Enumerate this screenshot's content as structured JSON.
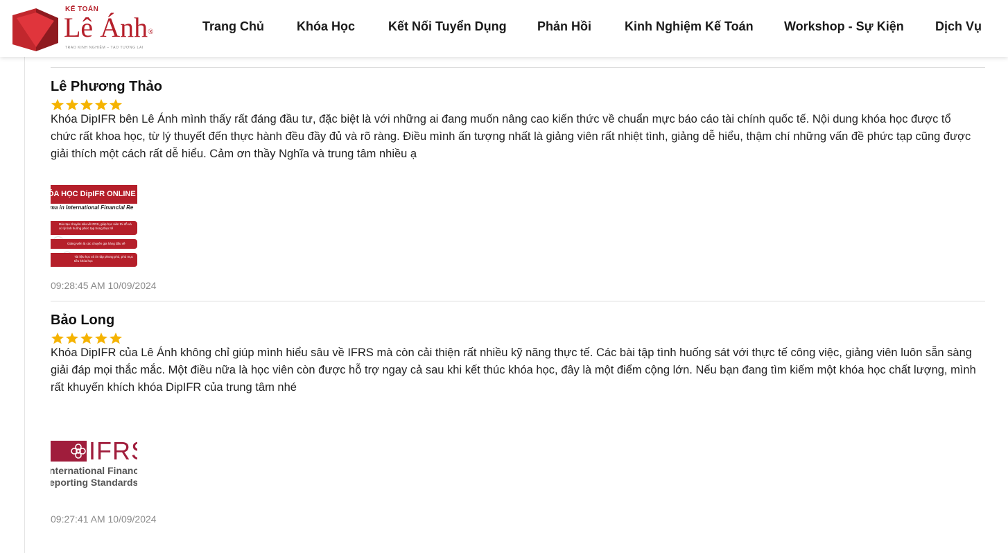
{
  "brand": {
    "top_label": "KẾ TOÁN",
    "name": "Lê Ánh",
    "registered": "®",
    "tagline": "TRAO KINH NGHIỆM – TẠO TƯƠNG LAI",
    "accent_color": "#b51f2a"
  },
  "nav": [
    {
      "label": "Trang Chủ"
    },
    {
      "label": "Khóa Học"
    },
    {
      "label": "Kết Nối Tuyển Dụng"
    },
    {
      "label": "Phản Hồi"
    },
    {
      "label": "Kinh Nghiệm Kế Toán"
    },
    {
      "label": "Workshop - Sự Kiện"
    },
    {
      "label": "Dịch Vụ"
    }
  ],
  "reviews": [
    {
      "name": "Lê Phương Thảo",
      "rating": 5,
      "text": "Khóa DipIFR bên Lê Ánh mình thấy rất đáng đầu tư, đặc biệt là với những ai đang muốn nâng cao kiến thức về chuẩn mực báo cáo tài chính quốc tế. Nội dung khóa học được tổ chức rất khoa học, từ lý thuyết đến thực hành đều đầy đủ và rõ ràng. Điều mình ấn tượng nhất là giảng viên rất nhiệt tình, giảng dễ hiểu, thậm chí những vấn đề phức tạp cũng được giải thích một cách rất dễ hiểu. Cảm ơn thầy Nghĩa và trung tâm nhiều ạ",
      "image": {
        "title": "ÓA HỌC DipIFR ONLINE",
        "subtitle": "oma in International Financial Re",
        "rows": [
          "Đào tạo chuyên sâu về IFRS, giúp học viên thi đỗ và xử lý tình huống phức tạp trong thực tế",
          "Giảng viên là các chuyên gia hàng đầu về",
          "Tài liệu học và ôn tập phong phú, phù mục tiêu khóa học"
        ]
      },
      "timestamp": "09:28:45 AM 10/09/2024"
    },
    {
      "name": "Bảo Long",
      "rating": 5,
      "text": "Khóa DipIFR của Lê Ánh không chỉ giúp mình hiểu sâu về IFRS mà còn cải thiện rất nhiều kỹ năng thực tế. Các bài tập tình huống sát với thực tế công việc, giảng viên luôn sẵn sàng giải đáp mọi thắc mắc. Một điều nữa là học viên còn được hỗ trợ ngay cả sau khi kết thúc khóa học, đây là một điểm cộng lớn. Nếu bạn đang tìm kiếm một khóa học chất lượng, mình rất khuyến khích khóa DipIFR của trung tâm nhé",
      "image": {
        "word": "IFRS",
        "line1": "nternational Financia",
        "line2": "eporting Standards"
      },
      "timestamp": "09:27:41 AM 10/09/2024"
    }
  ],
  "colors": {
    "star": "#f5b301",
    "ifrs": "#a01d3c"
  }
}
